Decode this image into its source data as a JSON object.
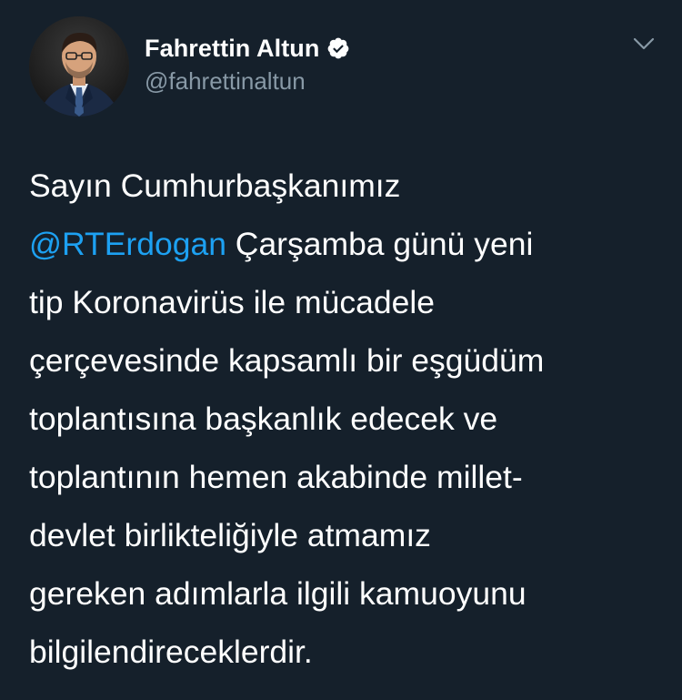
{
  "author": {
    "display_name": "Fahrettin Altun",
    "handle": "@fahrettinaltun",
    "verified": true,
    "avatar_icon": "profile-photo"
  },
  "menu": {
    "icon": "chevron-down-icon"
  },
  "tweet": {
    "line_1": "Sayın Cumhurbaşkanımız",
    "mention": "@RTErdogan",
    "line_2_rest": " Çarşamba günü yeni",
    "line_3": "tip Koronavirüs ile mücadele",
    "line_4": "çerçevesinde kapsamlı bir eşgüdüm",
    "line_5": "toplantısına başkanlık edecek ve",
    "line_6": "toplantının hemen akabinde millet-",
    "line_7": "devlet birlikteliğiyle atmamız",
    "line_8": "gereken adımlarla ilgili kamuoyunu",
    "line_9": "bilgilendireceklerdir."
  },
  "colors": {
    "background": "#15202b",
    "text": "#ffffff",
    "secondary_text": "#8899a6",
    "link": "#1da1f2"
  }
}
